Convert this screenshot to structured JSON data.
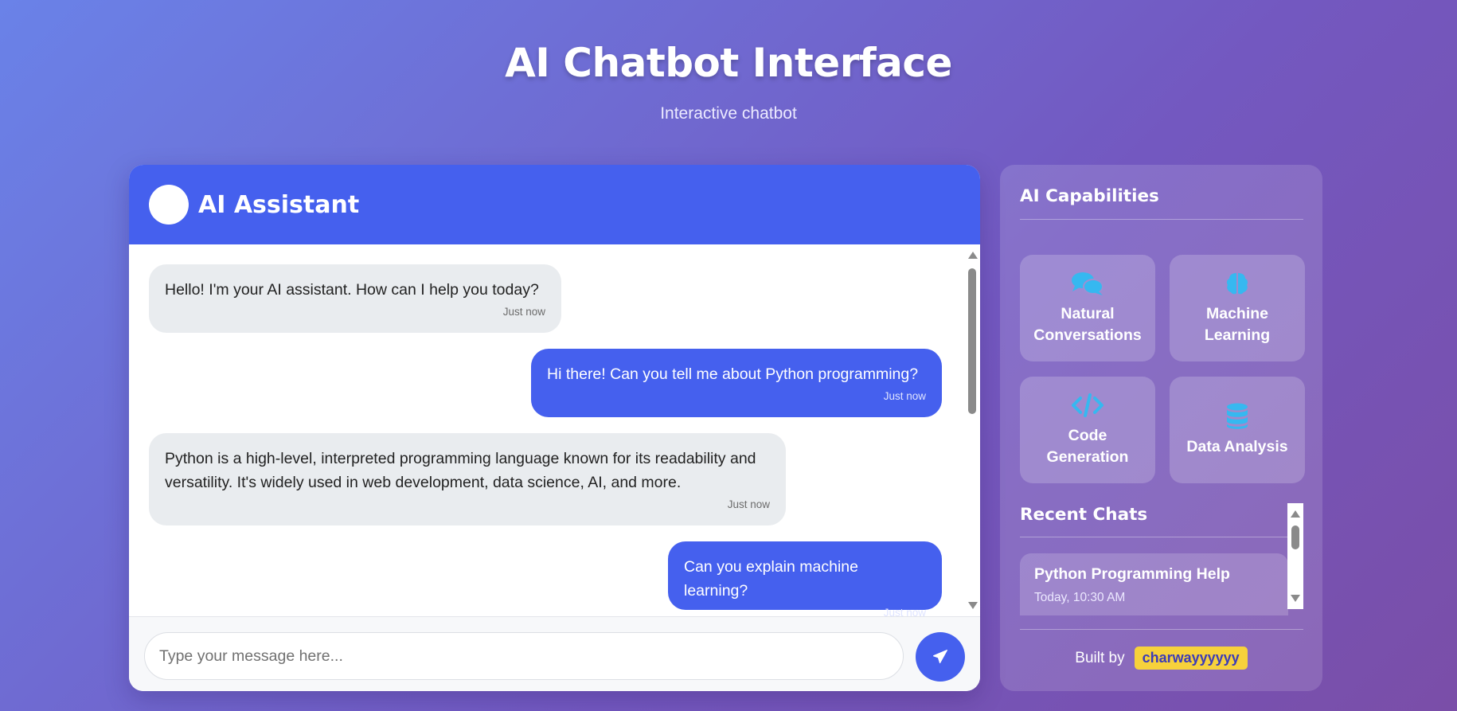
{
  "header": {
    "title": "AI Chatbot Interface",
    "subtitle": "Interactive chatbot"
  },
  "chat": {
    "assistant_name": "AI Assistant",
    "messages": [
      {
        "sender": "bot",
        "text": "Hello! I'm your AI assistant. How can I help you today?",
        "time": "Just now"
      },
      {
        "sender": "user",
        "text": "Hi there! Can you tell me about Python programming?",
        "time": "Just now"
      },
      {
        "sender": "bot",
        "text": "Python is a high-level, interpreted programming language known for its readability and versatility. It's widely used in web development, data science, AI, and more.",
        "time": "Just now"
      },
      {
        "sender": "user",
        "text": "Can you explain machine learning?",
        "time": "Just now"
      }
    ],
    "input": {
      "placeholder": "Type your message here...",
      "value": ""
    },
    "send_icon": "paper-plane-icon"
  },
  "sidebar": {
    "capabilities_title": "AI Capabilities",
    "capabilities": [
      {
        "label": "Natural Conversations",
        "icon": "comments-icon"
      },
      {
        "label": "Machine Learning",
        "icon": "brain-icon"
      },
      {
        "label": "Code Generation",
        "icon": "code-icon"
      },
      {
        "label": "Data Analysis",
        "icon": "database-icon"
      }
    ],
    "recent_title": "Recent Chats",
    "recent_chats": [
      {
        "title": "Python Programming Help",
        "time": "Today, 10:30 AM"
      }
    ],
    "built_by_label": "Built by",
    "author": "charwayyyyyy"
  },
  "colors": {
    "accent": "#4560ee",
    "icon": "#36b8f0",
    "badge": "#f7d13b"
  }
}
